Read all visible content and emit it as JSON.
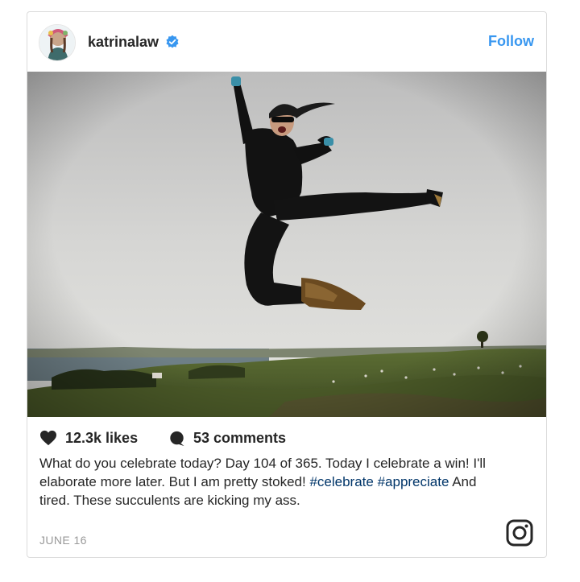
{
  "post": {
    "username": "katrinalaw",
    "follow_label": "Follow",
    "likes": "12.3k likes",
    "comments": "53 comments",
    "caption_text_1": "What do you celebrate today? Day 104 of 365. Today I celebrate a win! I'll elaborate more later. But I am pretty stoked! ",
    "hashtag_1": "#celebrate",
    "hashtag_2": "#appreciate",
    "caption_text_2": " And tired. These succulents are kicking my ass.",
    "date": "JUNE 16"
  },
  "colors": {
    "link_blue": "#3897f0",
    "hashtag_blue": "#003569",
    "muted_gray": "#999999"
  },
  "icons": {
    "verified": "verified-badge-icon",
    "like": "heart-icon",
    "comment": "comment-bubble-icon",
    "brand": "instagram-icon"
  }
}
